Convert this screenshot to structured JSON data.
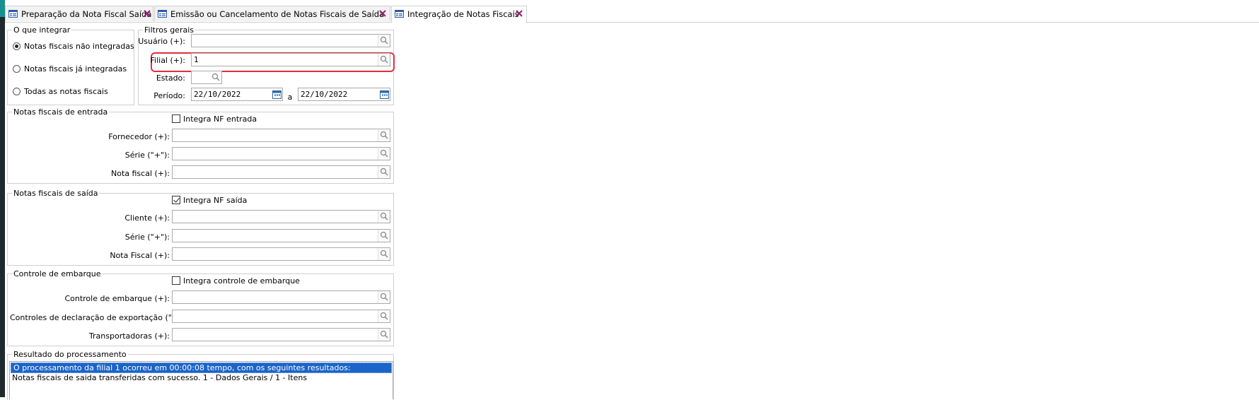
{
  "tabs": [
    {
      "label": "Preparação da Nota Fiscal Saída",
      "active": false
    },
    {
      "label": "Emissão ou Cancelamento de Notas Fiscais de Saída",
      "active": false
    },
    {
      "label": "Integração de Notas Fiscais",
      "active": true
    }
  ],
  "o_que_integrar": {
    "legend": "O que integrar",
    "options": [
      {
        "label": "Notas fiscais não integradas",
        "selected": true
      },
      {
        "label": "Notas fiscais já integradas",
        "selected": false
      },
      {
        "label": "Todas as notas fiscais",
        "selected": false
      }
    ]
  },
  "filtros_gerais": {
    "legend": "Filtros gerais",
    "usuario_label": "Usuário (+):",
    "usuario_value": "",
    "filial_label": "Filial (+):",
    "filial_value": "1",
    "estado_label": "Estado:",
    "estado_value": "",
    "periodo_label": "Período:",
    "periodo_from": "22/10/2022",
    "periodo_sep": "a",
    "periodo_to": "22/10/2022"
  },
  "nf_entrada": {
    "legend": "Notas fiscais de entrada",
    "checkbox_label": "Integra NF entrada",
    "checked": false,
    "fornecedor_label": "Fornecedor (+):",
    "serie_label": "Série (\"+\"):",
    "nota_label": "Nota fiscal (+):"
  },
  "nf_saida": {
    "legend": "Notas fiscais de saída",
    "checkbox_label": "Integra NF saída",
    "checked": true,
    "cliente_label": "Cliente (+):",
    "serie_label": "Série (\"+\"):",
    "nota_label": "Nota Fiscal (+):"
  },
  "embarque": {
    "legend": "Controle de embarque",
    "checkbox_label": "Integra controle de embarque",
    "checked": false,
    "controle_label": "Controle de embarque (+):",
    "declaracao_label": "Controles de declaração de exportação (\"+\"):",
    "transportadoras_label": "Transportadoras (+):"
  },
  "resultado": {
    "legend": "Resultado do processamento",
    "lines": [
      "O processamento da filial 1 ocorreu em 00:00:08 tempo, com os seguintes resultados:",
      "Notas fiscais de saida transferidas com sucesso. 1 - Dados Gerais / 1 - Itens"
    ]
  },
  "colors": {
    "highlight_border": "#e0303c",
    "selection": "#1b64c8",
    "close_icon": "#8a1f6a"
  }
}
